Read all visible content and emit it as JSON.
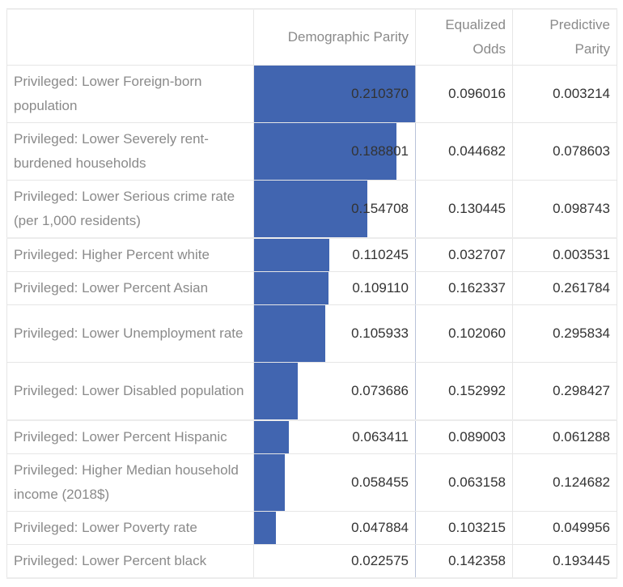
{
  "table": {
    "columns": [
      "",
      "Demographic Parity",
      "Equalized Odds",
      "Predictive Parity"
    ],
    "bar_color": "#4165b0",
    "bar_column": "Demographic Parity",
    "bar_max": 0.21037,
    "rows": [
      {
        "label": "Privileged: Lower Foreign-born population",
        "demographic_parity": "0.210370",
        "equalized_odds": "0.096016",
        "predictive_parity": "0.003214"
      },
      {
        "label": "Privileged: Lower Severely rent-burdened households",
        "demographic_parity": "0.188801",
        "equalized_odds": "0.044682",
        "predictive_parity": "0.078603"
      },
      {
        "label": "Privileged: Lower Serious crime rate (per 1,000 residents)",
        "demographic_parity": "0.154708",
        "equalized_odds": "0.130445",
        "predictive_parity": "0.098743"
      },
      {
        "label": "Privileged: Higher Percent white",
        "demographic_parity": "0.110245",
        "equalized_odds": "0.032707",
        "predictive_parity": "0.003531"
      },
      {
        "label": "Privileged: Lower Percent Asian",
        "demographic_parity": "0.109110",
        "equalized_odds": "0.162337",
        "predictive_parity": "0.261784"
      },
      {
        "label": "Privileged: Lower Unemployment rate",
        "demographic_parity": "0.105933",
        "equalized_odds": "0.102060",
        "predictive_parity": "0.295834"
      },
      {
        "label": "Privileged: Lower Disabled population",
        "demographic_parity": "0.073686",
        "equalized_odds": "0.152992",
        "predictive_parity": "0.298427"
      },
      {
        "label": "Privileged: Lower Percent Hispanic",
        "demographic_parity": "0.063411",
        "equalized_odds": "0.089003",
        "predictive_parity": "0.061288"
      },
      {
        "label": "Privileged: Higher Median household income (2018$)",
        "demographic_parity": "0.058455",
        "equalized_odds": "0.063158",
        "predictive_parity": "0.124682"
      },
      {
        "label": "Privileged: Lower Poverty rate",
        "demographic_parity": "0.047884",
        "equalized_odds": "0.103215",
        "predictive_parity": "0.049956"
      },
      {
        "label": "Privileged: Lower Percent black",
        "demographic_parity": "0.022575",
        "equalized_odds": "0.142358",
        "predictive_parity": "0.193445"
      }
    ]
  }
}
